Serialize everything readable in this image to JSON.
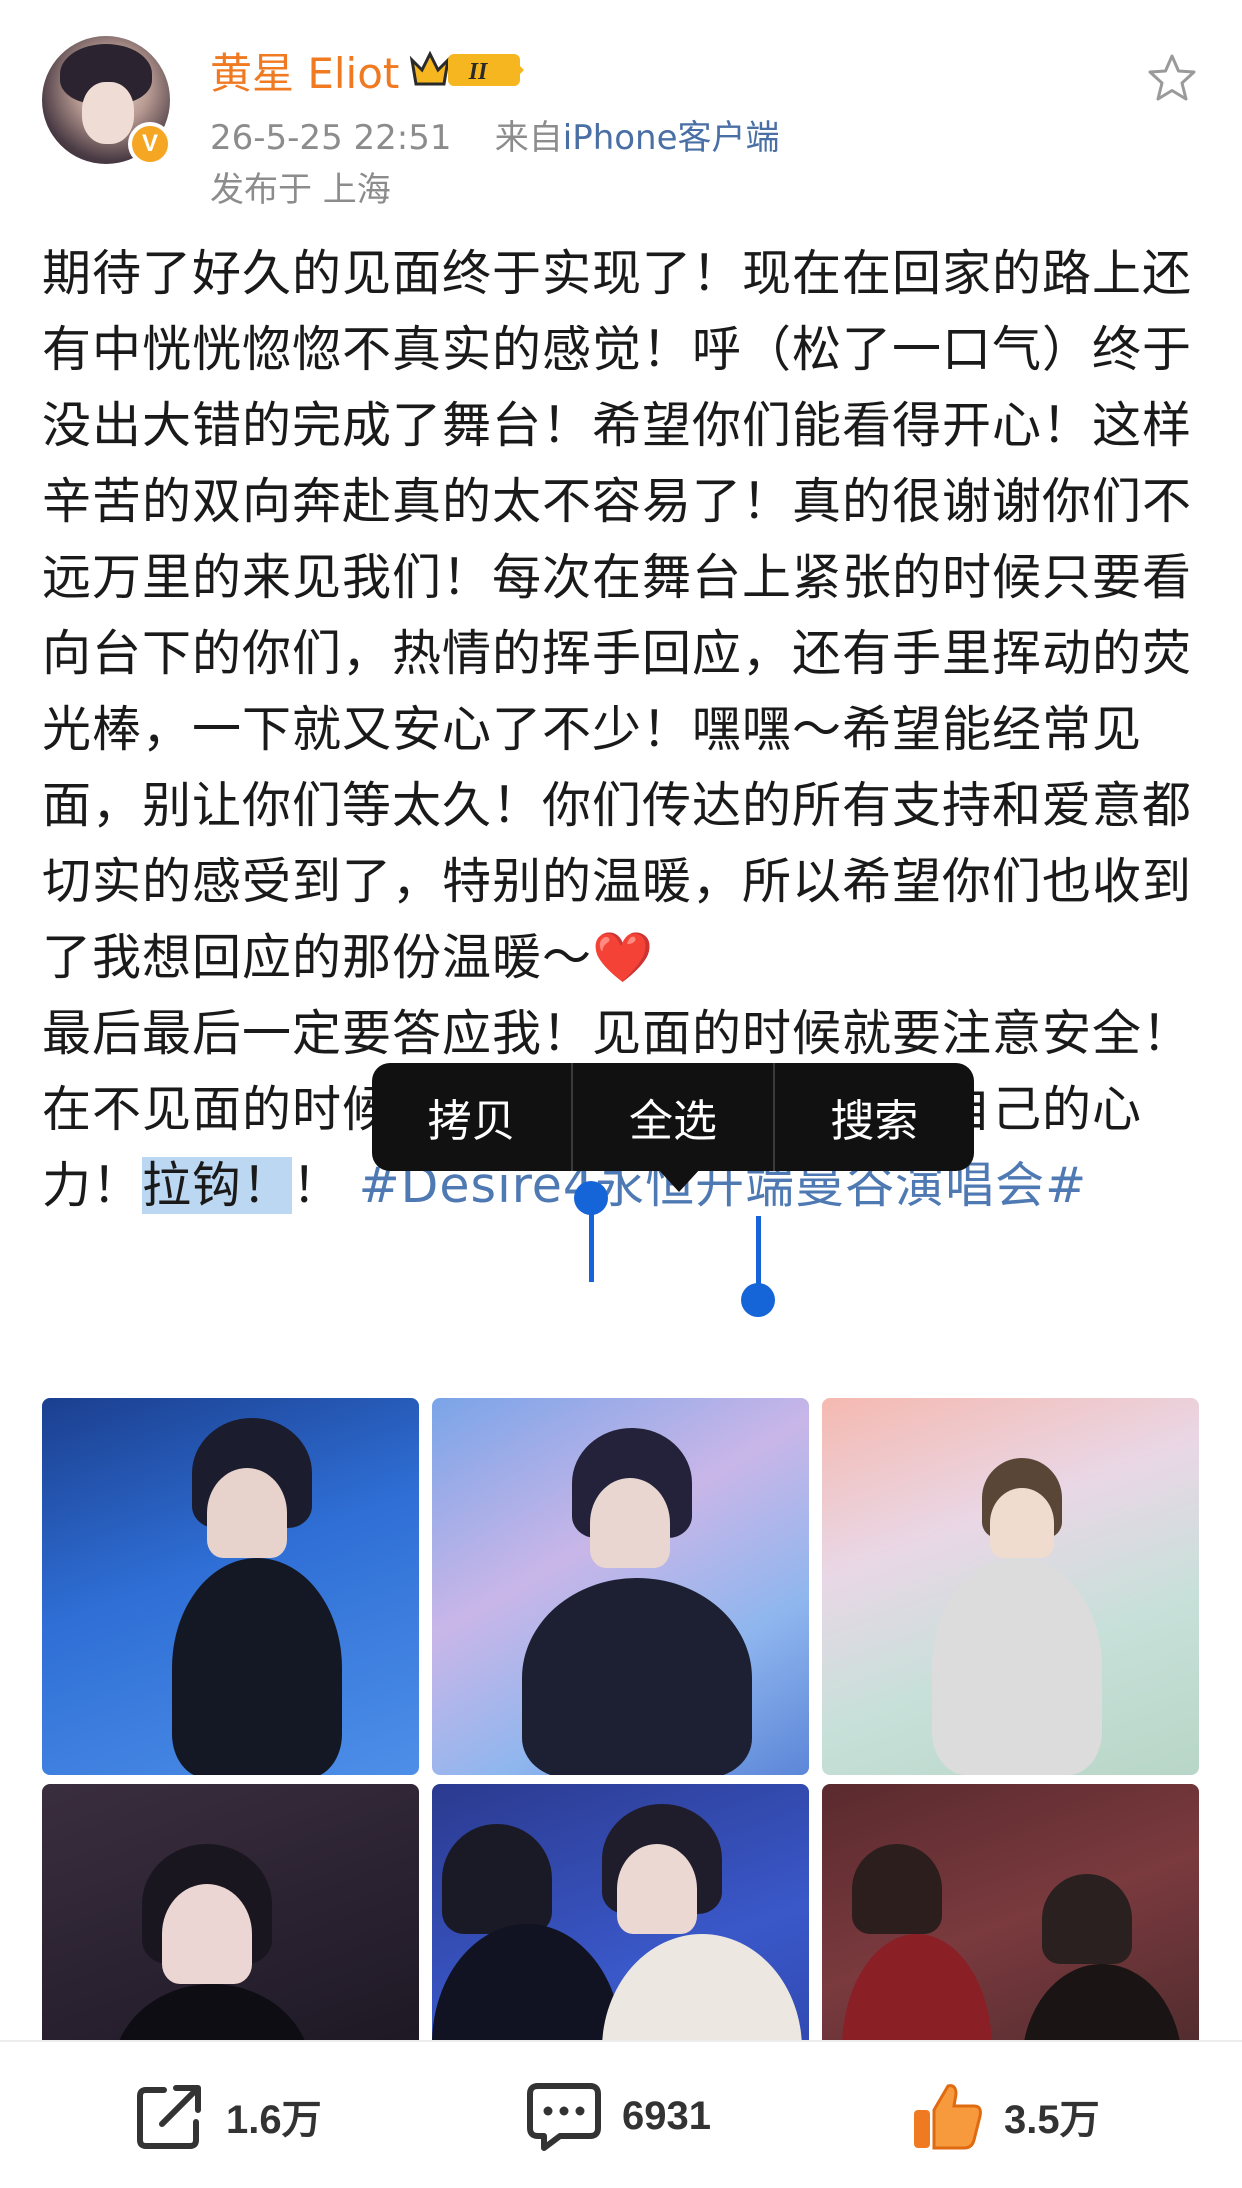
{
  "header": {
    "username": "黄星 Eliot",
    "rank_badge": "II",
    "timestamp": "26-5-25 22:51",
    "source_prefix": "来自",
    "client": "iPhone客户端",
    "location": "发布于 上海",
    "verified_mark": "V"
  },
  "post": {
    "para1": "期待了好久的见面终于实现了！现在在回家的路上还有中恍恍惚惚不真实的感觉！呼（松了一口气）终于没出大错的完成了舞台！希望你们能看得开心！这样辛苦的双向奔赴真的太不容易了！真的很谢谢你们不远万里的来见我们！每次在舞台上紧张的时候只要看向台下的你们，热情的挥手回应，还有手里挥动的荧光棒，一下就又安心了不少！嘿嘿～希望能经常见面，别让你们等太久！你们传达的所有支持和爱意都切实的感受到了，特别的温暖，所以希望你们也收到了我想回应的那份温暖～",
    "heart_emoji": "❤️",
    "para2_start": "最后最后一定",
    "para2_hidden": "要答应我！见",
    "para2_mid": "面的时候就要注意安全！在不见面的时候就要好好照顾自己守护好自己的心力！",
    "selected_text": "拉钩！",
    "after_selection": "！",
    "hashtag": "#Desire4永恒开端曼谷演唱会#"
  },
  "context_menu": {
    "copy": "拷贝",
    "select_all": "全选",
    "search": "搜索"
  },
  "actions": {
    "share_count": "1.6万",
    "comment_count": "6931",
    "like_count": "3.5万"
  },
  "colors": {
    "username": "#f07a21",
    "link": "#4f79b3",
    "selection": "#bcd7f2",
    "handle": "#1565d8",
    "like": "#f07a21"
  },
  "icons": {
    "favorite": "star-outline-icon",
    "share": "share-icon",
    "comment": "comment-icon",
    "like": "thumbs-up-icon"
  }
}
